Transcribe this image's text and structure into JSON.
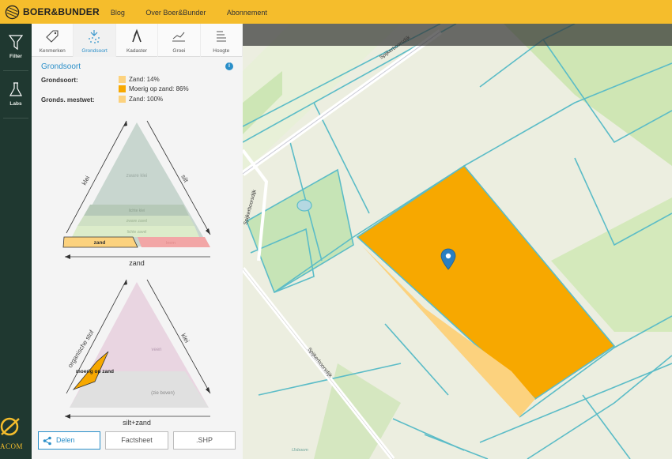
{
  "brand": {
    "name": "BOER&BUNDER",
    "accent": "#f5bd2c"
  },
  "nav": {
    "items": [
      "Blog",
      "Over Boer&Bunder",
      "Abonnement"
    ]
  },
  "rail": {
    "items": [
      {
        "label": "Filter",
        "icon": "filter-icon"
      },
      {
        "label": "Labs",
        "icon": "flask-icon"
      }
    ],
    "logo_text": "ACOM"
  },
  "tabs": [
    {
      "label": "Kenmerken",
      "icon": "tag-icon",
      "active": false
    },
    {
      "label": "Grondsoort",
      "icon": "soil-icon",
      "active": true
    },
    {
      "label": "Kadaster",
      "icon": "kadaster-icon",
      "active": false
    },
    {
      "label": "Groei",
      "icon": "growth-chart-icon",
      "active": false
    },
    {
      "label": "Hoogte",
      "icon": "height-icon",
      "active": false
    }
  ],
  "section": {
    "title": "Grondsoort",
    "grondsoort_label": "Grondsoort:",
    "mestwet_label": "Gronds. mestwet:",
    "grondsoort_legend": [
      {
        "text": "Zand: 14%",
        "color": "#fcd27e"
      },
      {
        "text": "Moerig op zand: 86%",
        "color": "#f7a800"
      }
    ],
    "mestwet_legend": [
      {
        "text": "Zand: 100%",
        "color": "#fcd27e"
      }
    ]
  },
  "triangle1": {
    "left_axis": "klei",
    "right_axis": "silt",
    "bottom_axis": "zand",
    "zones": [
      "zware klei",
      "lichte klei",
      "zware zavel",
      "lichte zavel",
      "zand",
      "leem"
    ]
  },
  "triangle2": {
    "left_axis": "organische stof",
    "right_axis": "klei",
    "bottom_axis": "silt+zand",
    "zones": [
      "veen",
      "moerig op zand",
      "(zie boven)"
    ]
  },
  "buttons": {
    "share": "Delen",
    "factsheet": "Factsheet",
    "shp": ".SHP"
  },
  "map": {
    "road_labels": [
      "Spijkerboorsdijk",
      "Spijkerboorsdijk",
      "Spijkerboorsdijk"
    ],
    "water_label": "IJsboom",
    "parcel_color": "#f7a800",
    "parcel_light_color": "#fcd27e",
    "pin_color": "#2a7fc0"
  }
}
